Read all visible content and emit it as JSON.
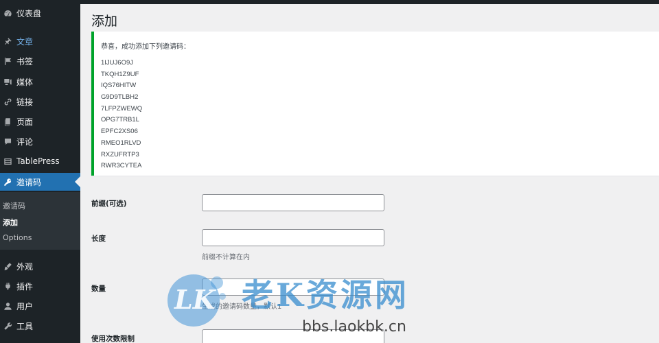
{
  "sidebar": {
    "items": [
      {
        "label": "仪表盘",
        "icon": "dashboard-icon"
      },
      {
        "label": "文章",
        "icon": "pin-icon"
      },
      {
        "label": "书签",
        "icon": "bookmark-icon"
      },
      {
        "label": "媒体",
        "icon": "media-icon"
      },
      {
        "label": "链接",
        "icon": "link-icon"
      },
      {
        "label": "页面",
        "icon": "page-icon"
      },
      {
        "label": "评论",
        "icon": "comment-icon"
      },
      {
        "label": "TablePress",
        "icon": "table-icon"
      },
      {
        "label": "邀请码",
        "icon": "key-icon"
      },
      {
        "label": "外观",
        "icon": "brush-icon"
      },
      {
        "label": "插件",
        "icon": "plugin-icon"
      },
      {
        "label": "用户",
        "icon": "user-icon"
      },
      {
        "label": "工具",
        "icon": "wrench-icon"
      }
    ],
    "submenu": [
      "邀请码",
      "添加",
      "Options"
    ]
  },
  "page": {
    "title": "添加",
    "notice": {
      "message": "恭喜，成功添加下列邀请码：",
      "codes": [
        "1IJUJ6O9J",
        "TKQH1Z9UF",
        "IQS76HITW",
        "G9D9TLBH2",
        "7LFPZWEWQ",
        "OPG7TRB1L",
        "EPFC2XS06",
        "RMEO1RLVD",
        "RXZUFRTP3",
        "RWR3CYTEA"
      ]
    },
    "form": {
      "prefix_label": "前缀(可选)",
      "length_label": "长度",
      "length_desc": "前缀不计算在内",
      "count_label": "数量",
      "count_desc": "生成的邀请码数量，默认1",
      "usage_label": "使用次数限制"
    }
  },
  "watermark": {
    "logo_text": "LK",
    "text": "老K资源网",
    "url": "bbs.laokbk.cn"
  },
  "colors": {
    "sidebar_bg": "#1d2327",
    "accent": "#2271b1",
    "success": "#00a32a"
  }
}
